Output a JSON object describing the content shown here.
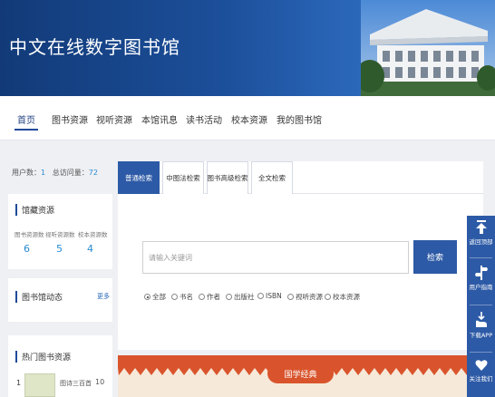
{
  "header": {
    "title": "中文在线数字图书馆"
  },
  "nav": {
    "items": [
      {
        "label": "首页"
      },
      {
        "label": "图书资源"
      },
      {
        "label": "视听资源"
      },
      {
        "label": "本馆讯息"
      },
      {
        "label": "读书活动"
      },
      {
        "label": "校本资源"
      },
      {
        "label": "我的图书馆"
      }
    ],
    "active_index": 0
  },
  "stats": {
    "users_label": "用户数：",
    "users_value": "1",
    "visits_label": "总访问量：",
    "visits_value": "72"
  },
  "collection": {
    "title": "馆藏资源",
    "items": [
      {
        "label": "图书资源数",
        "value": "6"
      },
      {
        "label": "视听资源数",
        "value": "5"
      },
      {
        "label": "校本资源数",
        "value": "4"
      }
    ]
  },
  "news": {
    "title": "图书馆动态",
    "more_label": "更多"
  },
  "hot_books": {
    "title": "热门图书资源",
    "items": [
      {
        "rank": "1",
        "name": "图诗三百首",
        "count": "10"
      }
    ]
  },
  "search": {
    "tabs": [
      {
        "label": "普通检索"
      },
      {
        "label": "中图法检索"
      },
      {
        "label": "图书高级检索"
      },
      {
        "label": "全文检索"
      }
    ],
    "placeholder": "请输入关键词",
    "button_label": "检索",
    "options": [
      {
        "label": "全部",
        "checked": true
      },
      {
        "label": "书名",
        "checked": false
      },
      {
        "label": "作者",
        "checked": false
      },
      {
        "label": "出版社",
        "checked": false
      },
      {
        "label": "ISBN",
        "checked": false
      },
      {
        "label": "视听资源",
        "checked": false
      },
      {
        "label": "校本资源",
        "checked": false
      }
    ]
  },
  "banner": {
    "label": "国学经典"
  },
  "float_bar": {
    "items": [
      {
        "label": "返回顶部",
        "icon": "arrow-up-icon"
      },
      {
        "label": "用户指南",
        "icon": "guide-icon"
      },
      {
        "label": "下载APP",
        "icon": "hand-download-icon"
      },
      {
        "label": "关注我们",
        "icon": "heart-icon"
      }
    ]
  },
  "colors": {
    "primary": "#2d5aa6",
    "accent": "#2a8bd0",
    "banner": "#d9542c"
  }
}
